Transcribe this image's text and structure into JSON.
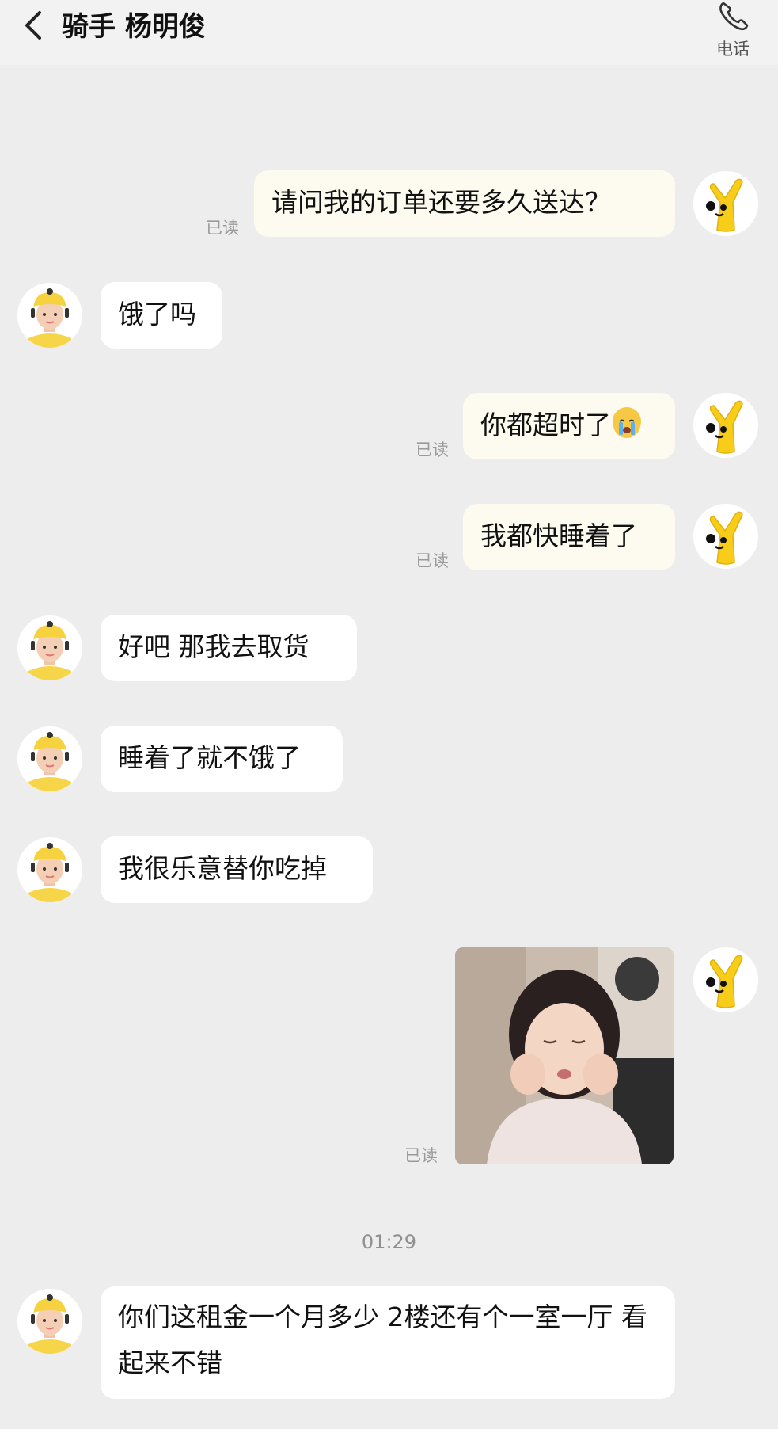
{
  "header": {
    "back_icon": "chevron-left-icon",
    "title": "骑手 杨明俊",
    "phone_icon": "phone-icon",
    "phone_label": "电话"
  },
  "colors": {
    "my_bubble": "#fdfbef",
    "other_bubble": "#ffffff",
    "background": "#ededed",
    "read_text": "#9a9a9a"
  },
  "messages": [
    {
      "from": "me",
      "text": "请问我的订单还要多久送达？",
      "status": "已读"
    },
    {
      "from": "rider",
      "text": "饿了吗"
    },
    {
      "from": "me",
      "text": "你都超时了",
      "emoji": "crying-face",
      "status": "已读"
    },
    {
      "from": "me",
      "text": "我都快睡着了",
      "status": "已读"
    },
    {
      "from": "rider",
      "text": "好吧  那我去取货"
    },
    {
      "from": "rider",
      "text": "睡着了就不饿了"
    },
    {
      "from": "rider",
      "text": "我很乐意替你吃掉"
    },
    {
      "from": "me",
      "type": "image",
      "image": "sticker-photo-child-squishing-face",
      "status": "已读"
    },
    {
      "type": "timestamp",
      "text": "01:29"
    },
    {
      "from": "rider",
      "text": "你们这租金一个月多少  2楼还有个一室一厅  看起来不错"
    }
  ]
}
